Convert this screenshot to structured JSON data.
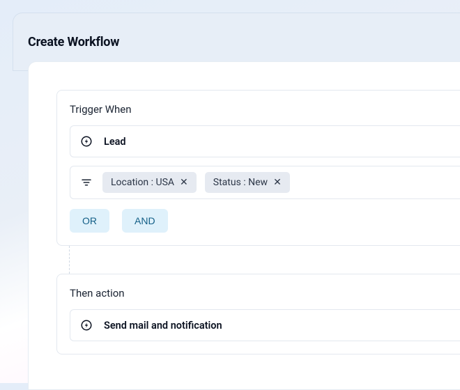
{
  "page": {
    "title": "Create Workflow"
  },
  "trigger": {
    "section_title": "Trigger When",
    "selector_label": "Lead",
    "filters": [
      {
        "label": "Location : USA"
      },
      {
        "label": "Status : New"
      }
    ],
    "operators": {
      "or_label": "OR",
      "and_label": "AND"
    }
  },
  "action": {
    "section_title": "Then action",
    "selector_label": "Send mail and notification"
  }
}
